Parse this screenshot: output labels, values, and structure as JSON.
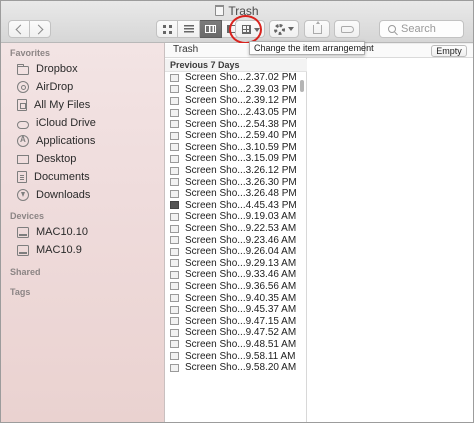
{
  "window": {
    "title": "Trash"
  },
  "toolbar": {
    "search_placeholder": "Search",
    "tooltip": "Change the item arrangement",
    "accent_color": "#d9231e"
  },
  "sidebar": {
    "sections": {
      "favorites": "Favorites",
      "devices": "Devices",
      "shared": "Shared",
      "tags": "Tags"
    },
    "favorites": [
      {
        "label": "Dropbox",
        "icon": "folder-icon"
      },
      {
        "label": "AirDrop",
        "icon": "airdrop-icon"
      },
      {
        "label": "All My Files",
        "icon": "all-files-icon"
      },
      {
        "label": "iCloud Drive",
        "icon": "cloud-icon"
      },
      {
        "label": "Applications",
        "icon": "applications-icon"
      },
      {
        "label": "Desktop",
        "icon": "desktop-icon"
      },
      {
        "label": "Documents",
        "icon": "document-icon"
      },
      {
        "label": "Downloads",
        "icon": "download-icon"
      }
    ],
    "devices": [
      {
        "label": "MAC10.10",
        "icon": "disk-icon"
      },
      {
        "label": "MAC10.9",
        "icon": "disk-icon"
      }
    ]
  },
  "main": {
    "path_label": "Trash",
    "empty_button": "Empty",
    "section_header": "Previous 7 Days",
    "files": [
      "Screen Sho...2.37.02 PM",
      "Screen Sho...2.39.03 PM",
      "Screen Sho...2.39.12 PM",
      "Screen Sho...2.43.05 PM",
      "Screen Sho...2.54.38 PM",
      "Screen Sho...2.59.40 PM",
      "Screen Sho...3.10.59 PM",
      "Screen Sho...3.15.09 PM",
      "Screen Sho...3.26.12 PM",
      "Screen Sho...3.26.30 PM",
      "Screen Sho...3.26.48 PM",
      "Screen Sho...4.45.43 PM",
      "Screen Sho...9.19.03 AM",
      "Screen Sho...9.22.53 AM",
      "Screen Sho...9.23.46 AM",
      "Screen Sho...9.26.04 AM",
      "Screen Sho...9.29.13 AM",
      "Screen Sho...9.33.46 AM",
      "Screen Sho...9.36.56 AM",
      "Screen Sho...9.40.35 AM",
      "Screen Sho...9.45.37 AM",
      "Screen Sho...9.47.15 AM",
      "Screen Sho...9.47.52 AM",
      "Screen Sho...9.48.51 AM",
      "Screen Sho...9.58.11 AM",
      "Screen Sho...9.58.20 AM"
    ]
  }
}
